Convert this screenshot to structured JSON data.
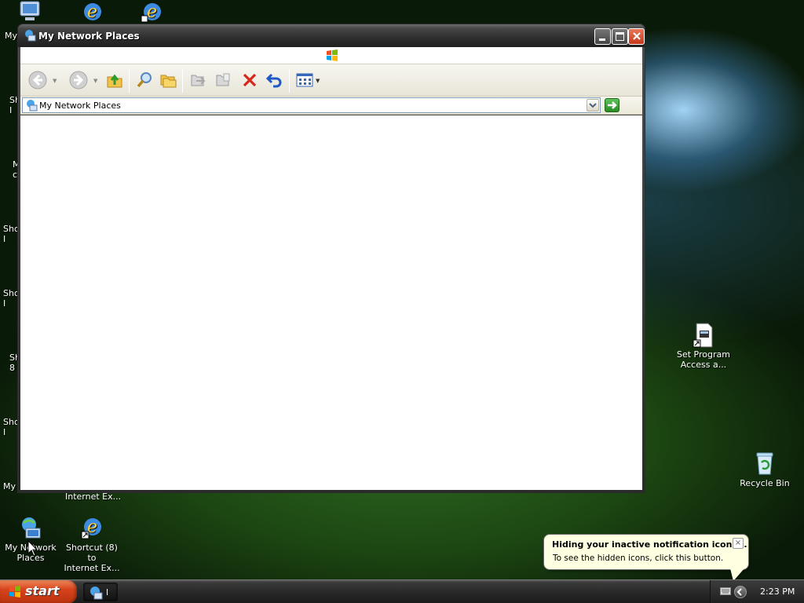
{
  "window": {
    "title": "My Network Places",
    "address": "My Network Places"
  },
  "desktop": {
    "icons": [
      {
        "name": "my-network-places",
        "label_line1": "My Network",
        "label_line2": "Places"
      },
      {
        "name": "shortcut-8-ie",
        "label_line1": "Shortcut (8) to",
        "label_line2": "Internet Ex..."
      },
      {
        "name": "set-program-access",
        "label_line1": "Set Program",
        "label_line2": "Access a..."
      },
      {
        "name": "recycle-bin",
        "label_line1": "Recycle Bin",
        "label_line2": ""
      }
    ],
    "partial_labels": {
      "my_top": "My",
      "sh_1": "Sh\nI",
      "m_1": "M\nc",
      "sho_1": "Sho\nI",
      "sho_2": "Sho\nI",
      "sh_2": "Sh\n8",
      "sho_3": "Sho\nI",
      "my_bottom": "My I",
      "internet_ex_fragment": "Internet Ex..."
    }
  },
  "taskbar": {
    "start_label": "start",
    "task_label": "l",
    "clock": "2:23 PM"
  },
  "balloon": {
    "title": "Hiding your inactive notification icons...",
    "text": "To see the hidden icons, click this button.",
    "close_glyph": "×"
  },
  "icons": {
    "title_icon": "network-places-icon",
    "back": "back-arrow-icon",
    "forward": "forward-arrow-icon",
    "up": "folder-up-icon",
    "search": "search-icon",
    "folders": "folders-icon",
    "move_to": "move-to-icon",
    "copy_to": "copy-to-icon",
    "delete": "delete-icon",
    "undo": "undo-icon",
    "views": "views-icon",
    "go": "go-arrow-icon"
  }
}
